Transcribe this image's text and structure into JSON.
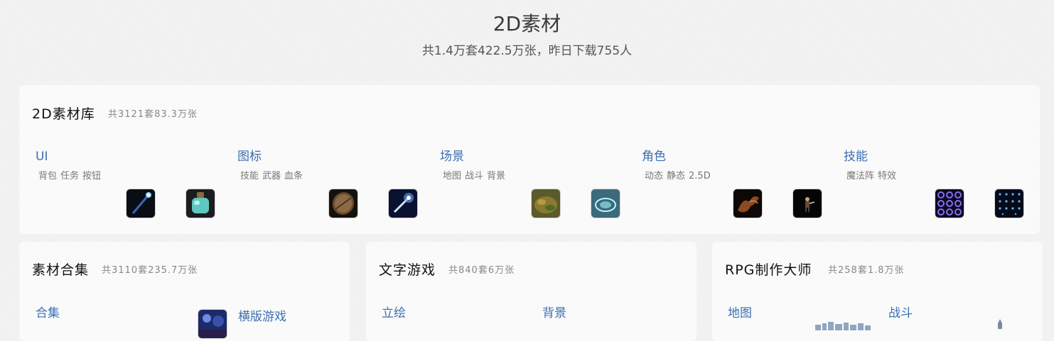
{
  "header": {
    "title": "2D素材",
    "subtitle": "共1.4万套422.5万张，昨日下载755人"
  },
  "library": {
    "title": "2D素材库",
    "count": "共3121套83.3万张",
    "categories": [
      {
        "name": "UI",
        "tags": [
          "背包",
          "任务",
          "按钮"
        ],
        "thumbs": [
          "wand-icon",
          "potion-icon"
        ]
      },
      {
        "name": "图标",
        "tags": [
          "技能",
          "武器",
          "血条"
        ],
        "thumbs": [
          "shield-icon",
          "sword-icon"
        ]
      },
      {
        "name": "场景",
        "tags": [
          "地图",
          "战斗",
          "背景"
        ],
        "thumbs": [
          "terrain-icon",
          "magic-circle-icon"
        ]
      },
      {
        "name": "角色",
        "tags": [
          "动态",
          "静态",
          "2.5D"
        ],
        "thumbs": [
          "dragon-icon",
          "warrior-icon"
        ]
      },
      {
        "name": "技能",
        "tags": [
          "魔法阵",
          "特效"
        ],
        "thumbs": [
          "purple-rings-icon",
          "blue-sparks-icon"
        ]
      }
    ]
  },
  "collection": {
    "title": "素材合集",
    "count": "共3110套235.7万张",
    "categories": [
      {
        "name": "合集",
        "thumb": ""
      },
      {
        "name": "横版游戏",
        "thumb": "night-scene-icon"
      }
    ]
  },
  "textgame": {
    "title": "文字游戏",
    "count": "共840套6万张",
    "categories": [
      {
        "name": "立绘"
      },
      {
        "name": "背景"
      }
    ]
  },
  "rpg": {
    "title": "RPG制作大师",
    "count": "共258套1.8万张",
    "categories": [
      {
        "name": "地图",
        "thumb": "city-icon"
      },
      {
        "name": "战斗",
        "thumb": "tower-icon"
      }
    ]
  }
}
